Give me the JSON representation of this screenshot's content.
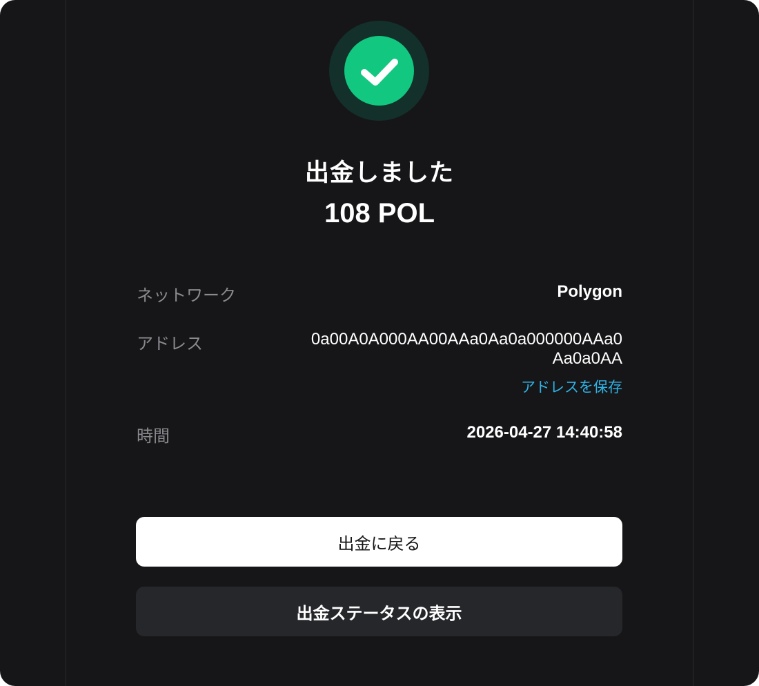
{
  "result": {
    "icon": "check-circle-icon",
    "title": "出金しました",
    "amount": "108 POL"
  },
  "details": {
    "network_label": "ネットワーク",
    "network_value": "Polygon",
    "address_label": "アドレス",
    "address_value": "0a00A0A000AA00AAa0Aa0a000000AAa0Aa0a0AA",
    "save_address_label": "アドレスを保存",
    "time_label": "時間",
    "time_value": "2026-04-27 14:40:58"
  },
  "actions": {
    "back_label": "出金に戻る",
    "status_label": "出金ステータスの表示"
  },
  "colors": {
    "background": "#161618",
    "success": "#12c77f",
    "success_ring": "#13302a",
    "link": "#2fb3e6",
    "secondary_button": "#26272b"
  }
}
